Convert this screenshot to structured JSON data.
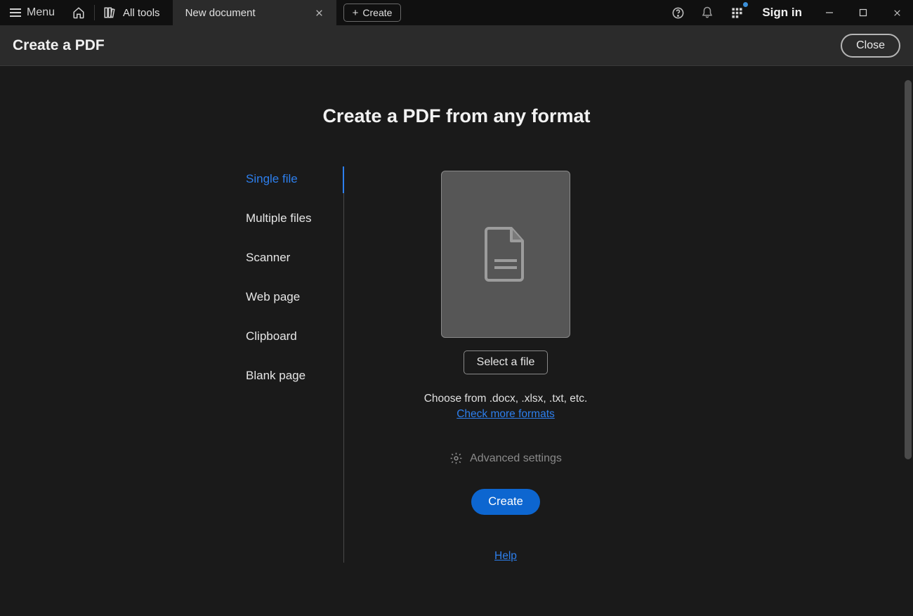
{
  "topbar": {
    "menu_label": "Menu",
    "all_tools_label": "All tools",
    "tab_label": "New document",
    "create_label": "Create",
    "signin_label": "Sign in"
  },
  "subheader": {
    "title": "Create a PDF",
    "close_label": "Close"
  },
  "main": {
    "title": "Create a PDF from any format",
    "sources": [
      "Single file",
      "Multiple files",
      "Scanner",
      "Web page",
      "Clipboard",
      "Blank page"
    ],
    "select_file_label": "Select a file",
    "hint_text": "Choose from .docx, .xlsx, .txt, etc.",
    "check_formats_label": "Check more formats",
    "advanced_label": "Advanced settings",
    "create_button_label": "Create",
    "help_label": "Help"
  }
}
